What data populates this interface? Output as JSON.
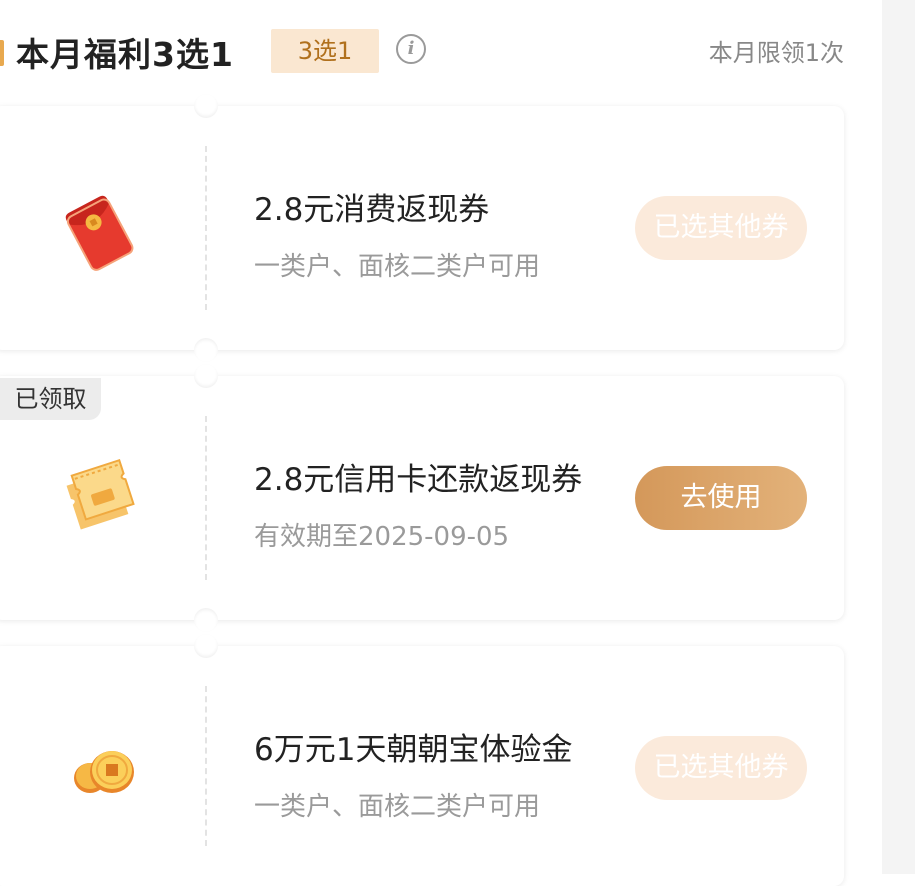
{
  "header": {
    "title": "本月福利3选1",
    "tag": "3选1",
    "info_symbol": "i",
    "limit_text": "本月限领1次"
  },
  "coupons": [
    {
      "icon": "red-envelope-icon",
      "title": "2.8元消费返现券",
      "subtitle": "一类户、面核二类户可用",
      "button_label": "已选其他券",
      "button_state": "disabled"
    },
    {
      "icon": "coupon-tickets-icon",
      "badge": "已领取",
      "title": "2.8元信用卡还款返现券",
      "subtitle": "有效期至2025-09-05",
      "button_label": "去使用",
      "button_state": "active"
    },
    {
      "icon": "gold-coins-icon",
      "title": "6万元1天朝朝宝体验金",
      "subtitle": "一类户、面核二类户可用",
      "button_label": "已选其他券",
      "button_state": "disabled"
    }
  ],
  "colors": {
    "accent": "#e8a94f",
    "tag_bg": "#fae7d1",
    "tag_text": "#b0701c",
    "button_active": "#d4985a",
    "button_disabled": "#fbeadb"
  }
}
